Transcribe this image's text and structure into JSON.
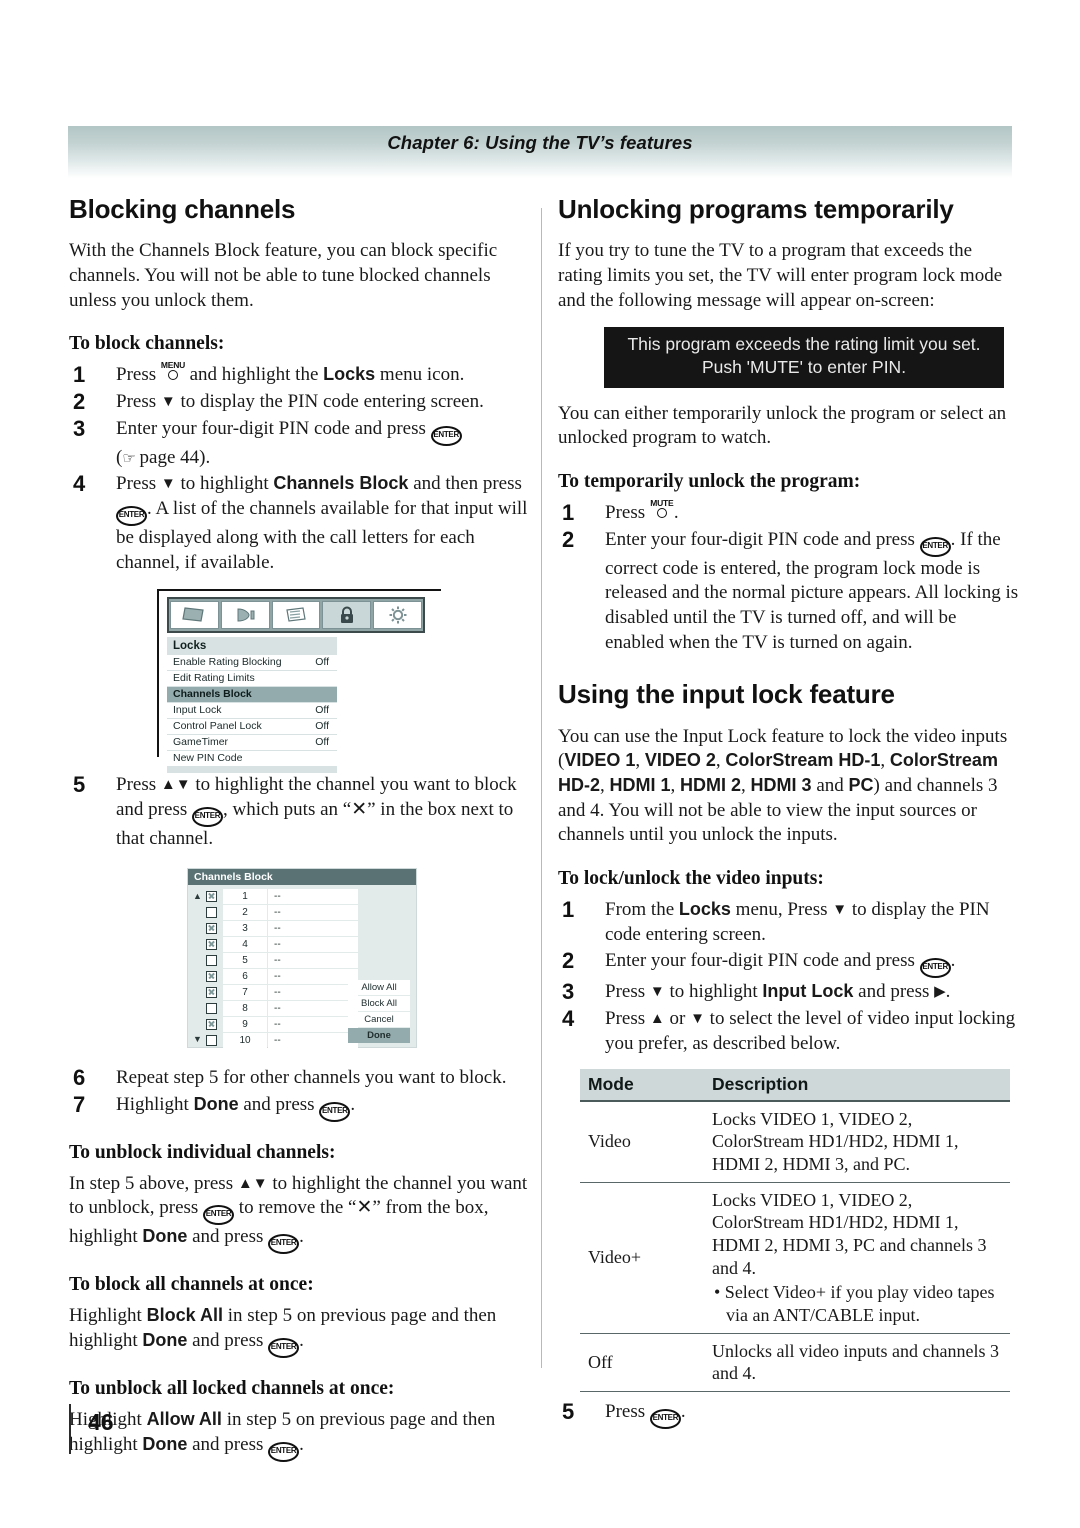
{
  "header": {
    "chapter": "Chapter 6: Using the TV’s features"
  },
  "footer": {
    "page_number": "46"
  },
  "left_column": {
    "section_title": "Blocking channels",
    "intro": "With the Channels Block feature, you can block specific channels. You will not be able to tune blocked channels unless you unlock them.",
    "to_block_heading": "To block channels:",
    "steps": [
      {
        "num": "1",
        "pre": "Press ",
        "key": "MENU",
        "post": " and highlight the ",
        "bold": "Locks",
        "tail": " menu icon."
      },
      {
        "num": "2",
        "text_a": "Press ",
        "text_b": " to display the PIN code entering screen."
      },
      {
        "num": "3",
        "text_a": "Enter your four-digit PIN code and press ",
        "text_b": " (",
        "page_ref": "page 44",
        "text_c": ")."
      },
      {
        "num": "4",
        "text_a": "Press ",
        "text_b": " to highlight ",
        "bold": "Channels Block",
        "text_c": " and then press ",
        "text_d": ". A list of the channels available for that input will be displayed along with the call letters for each channel, if available."
      },
      {
        "num": "5",
        "text_a": "Press ",
        "text_b": " to highlight the channel you want to block and press ",
        "text_c": ", which puts an “✕” in the box next to that channel."
      },
      {
        "num": "6",
        "text_a": "Repeat step 5 for other channels you want to block."
      },
      {
        "num": "7",
        "text_a": "Highlight ",
        "bold": "Done",
        "text_b": " and press ",
        "text_c": "."
      }
    ],
    "locks_menu_shot": {
      "icons": [
        "picture-icon",
        "audio-icon",
        "settings-icon",
        "lock-icon",
        "setup-icon"
      ],
      "selected_icon_index": 3,
      "title": "Locks",
      "rows": [
        {
          "label": "Enable Rating Blocking",
          "value": "Off",
          "highlighted": false
        },
        {
          "label": "Edit Rating Limits",
          "value": "",
          "highlighted": false
        },
        {
          "label": "Channels Block",
          "value": "",
          "highlighted": true
        },
        {
          "label": "Input Lock",
          "value": "Off",
          "highlighted": false
        },
        {
          "label": "Control Panel Lock",
          "value": "Off",
          "highlighted": false
        },
        {
          "label": "GameTimer",
          "value": "Off",
          "highlighted": false
        },
        {
          "label": "New PIN Code",
          "value": "",
          "highlighted": false
        }
      ]
    },
    "channels_block_shot": {
      "title": "Channels Block",
      "rows": [
        {
          "checked": true,
          "channel": "1",
          "call": "--"
        },
        {
          "checked": false,
          "channel": "2",
          "call": "--"
        },
        {
          "checked": true,
          "channel": "3",
          "call": "--"
        },
        {
          "checked": true,
          "channel": "4",
          "call": "--"
        },
        {
          "checked": false,
          "channel": "5",
          "call": "--"
        },
        {
          "checked": true,
          "channel": "6",
          "call": "--"
        },
        {
          "checked": true,
          "channel": "7",
          "call": "--"
        },
        {
          "checked": false,
          "channel": "8",
          "call": "--"
        },
        {
          "checked": true,
          "channel": "9",
          "call": "--"
        },
        {
          "checked": false,
          "channel": "10",
          "call": "--"
        }
      ],
      "buttons": [
        {
          "label": "Allow All",
          "highlighted": false
        },
        {
          "label": "Block All",
          "highlighted": false
        },
        {
          "label": "Cancel",
          "highlighted": false
        },
        {
          "label": "Done",
          "highlighted": true
        }
      ]
    },
    "unblock_individual_heading": "To unblock individual channels:",
    "unblock_individual_a": "In step 5 above, press ",
    "unblock_individual_b": " to highlight the channel you want to unblock, press ",
    "unblock_individual_c": " to remove the “✕” from the box, highlight ",
    "unblock_individual_done": "Done",
    "unblock_individual_d": " and press ",
    "block_all_heading": "To block all channels at once:",
    "block_all_a": "Highlight ",
    "block_all_bold": "Block All",
    "block_all_b": " in step 5 on previous page and then highlight ",
    "block_all_done": "Done",
    "block_all_c": " and press ",
    "unblock_all_heading": "To unblock all locked channels at once:",
    "unblock_all_a": "Highlight ",
    "unblock_all_bold": "Allow All",
    "unblock_all_b": " in step 5 on previous page and then highlight ",
    "unblock_all_done": "Done",
    "unblock_all_c": " and press "
  },
  "right_column": {
    "section_title": "Unlocking programs temporarily",
    "intro": "If you try to tune the TV to a program that exceeds the rating limits you set, the TV will enter program lock mode and the following message will appear on-screen:",
    "osd_message_line1": "This program exceeds the rating limit you set.",
    "osd_message_line2": "Push 'MUTE' to enter PIN.",
    "after_osd": "You can either temporarily unlock the program or select an unlocked program to watch.",
    "temp_unlock_heading": "To temporarily unlock the program:",
    "temp_steps": [
      {
        "num": "1",
        "text_a": "Press ",
        "key": "MUTE",
        "text_b": "."
      },
      {
        "num": "2",
        "text_a": "Enter your four-digit PIN code and press ",
        "text_b": ". If the correct code is entered, the program lock mode is released and the normal picture appears. All locking is disabled until the TV is turned off, and will be enabled when the TV is turned on again."
      }
    ],
    "input_lock_title": "Using the input lock feature",
    "input_lock_intro_a": "You can use the Input Lock feature to lock the video inputs (",
    "input_lock_inputs": [
      "VIDEO 1",
      "VIDEO 2",
      "ColorStream HD-1",
      "ColorStream HD-2",
      "HDMI 1",
      "HDMI 2",
      "HDMI 3",
      "PC"
    ],
    "input_lock_intro_b": ") and channels 3 and 4. You will not be able to view the input sources or channels until you unlock the inputs.",
    "lock_unlock_heading": "To lock/unlock the video inputs:",
    "lock_steps": [
      {
        "num": "1",
        "text_a": "From the ",
        "bold": "Locks",
        "text_b": " menu, Press ",
        "text_c": " to display the PIN code entering screen."
      },
      {
        "num": "2",
        "text_a": "Enter your four-digit PIN code and press ",
        "text_b": "."
      },
      {
        "num": "3",
        "text_a": "Press ",
        "text_b": " to highlight ",
        "bold": "Input Lock",
        "text_c": " and press ",
        "text_d": "."
      },
      {
        "num": "4",
        "text_a": "Press ",
        "text_b": " or ",
        "text_c": " to select the level of video input locking you prefer, as described below."
      }
    ],
    "mode_table": {
      "headers": [
        "Mode",
        "Description"
      ],
      "rows": [
        {
          "mode": "Video",
          "description": "Locks VIDEO 1, VIDEO 2, ColorStream HD1/HD2, HDMI 1, HDMI 2, HDMI 3, and PC.",
          "bullet": ""
        },
        {
          "mode": "Video+",
          "description": "Locks VIDEO 1, VIDEO 2, ColorStream HD1/HD2, HDMI 1, HDMI 2, HDMI 3, PC and channels 3 and 4.",
          "bullet": "•  Select Video+ if you play video tapes via an ANT/CABLE input.",
          "bullet_bold": "Video+"
        },
        {
          "mode": "Off",
          "description": "Unlocks all video inputs and channels 3 and 4.",
          "bullet": ""
        }
      ]
    },
    "final_step": {
      "num": "5",
      "text_a": "Press ",
      "text_b": "."
    }
  }
}
